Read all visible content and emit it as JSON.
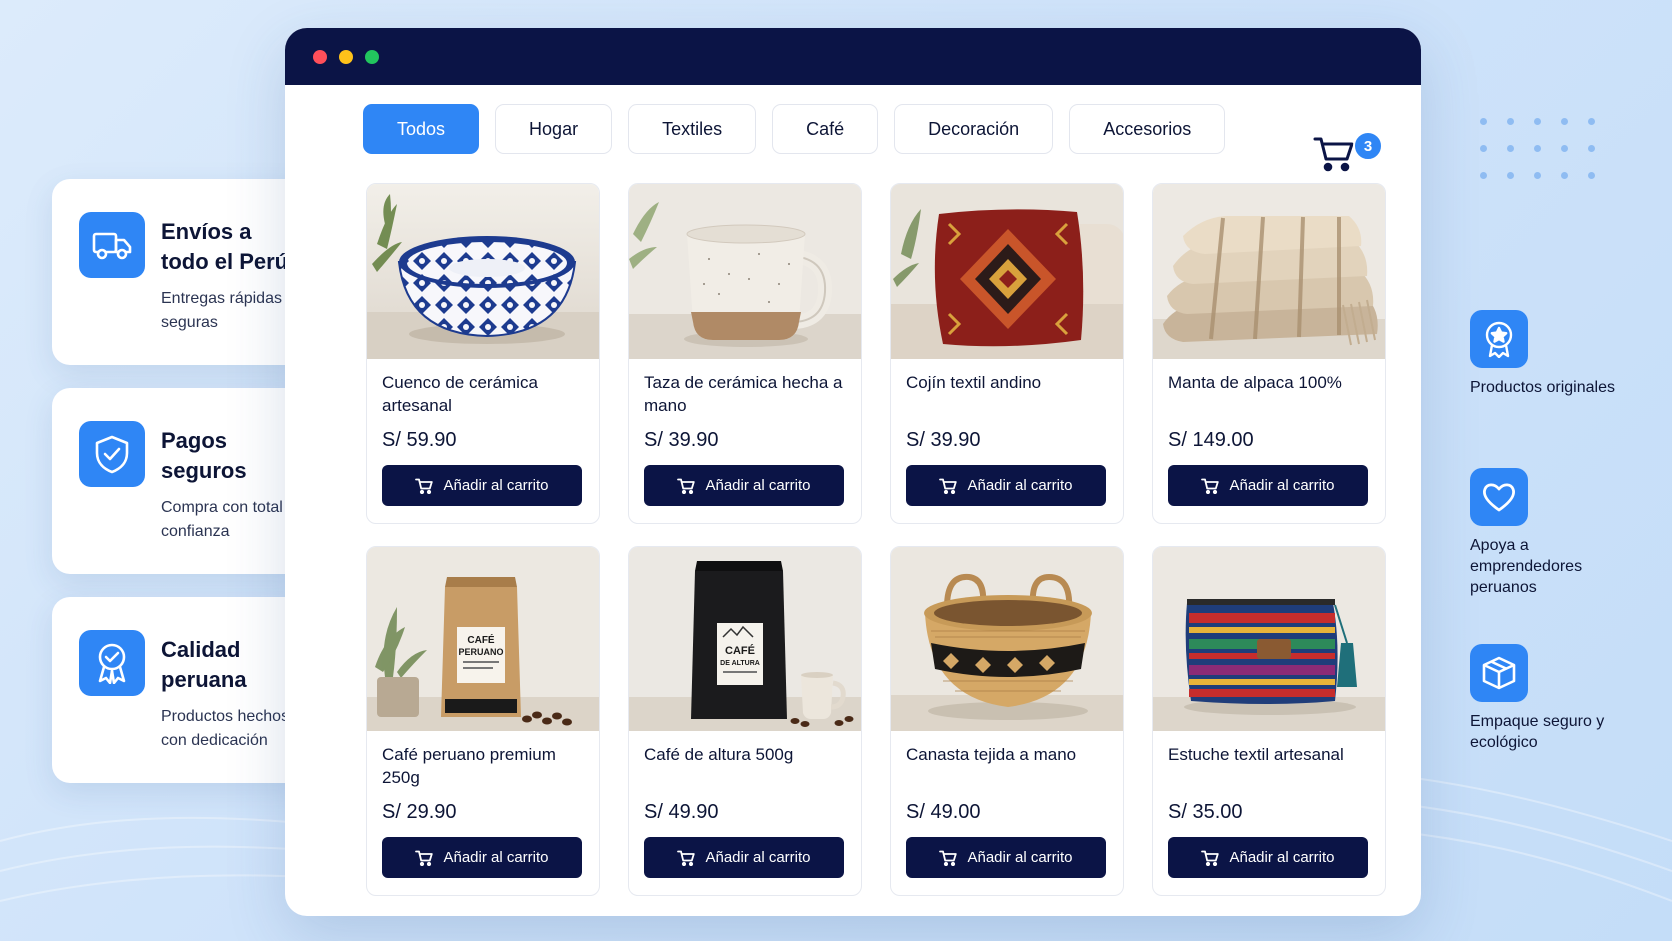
{
  "window": {
    "controls": [
      "close",
      "minimize",
      "maximize"
    ]
  },
  "categories": [
    "Todos",
    "Hogar",
    "Textiles",
    "Café",
    "Decoración",
    "Accesorios"
  ],
  "active_category": "Todos",
  "cart": {
    "icon": "cart-icon",
    "count": "3"
  },
  "products": [
    {
      "name": "Cuenco de cerámica artesanal",
      "price": "S/ 59.90",
      "button": "Añadir al carrito",
      "image": "ceramic-bowl"
    },
    {
      "name": "Taza de cerámica hecha a mano",
      "price": "S/ 39.90",
      "button": "Añadir al carrito",
      "image": "ceramic-mug"
    },
    {
      "name": "Cojín textil andino",
      "price": "S/ 39.90",
      "button": "Añadir al carrito",
      "image": "andean-cushion"
    },
    {
      "name": "Manta de alpaca 100%",
      "price": "S/ 149.00",
      "button": "Añadir al carrito",
      "image": "alpaca-blanket"
    },
    {
      "name": "Café peruano premium 250g",
      "price": "S/ 29.90",
      "button": "Añadir al carrito",
      "image": "coffee-bag-kraft",
      "label_lines": [
        "CAFÉ",
        "PERUANO"
      ]
    },
    {
      "name": "Café de altura 500g",
      "price": "S/ 49.90",
      "button": "Añadir al carrito",
      "image": "coffee-bag-black",
      "label_lines": [
        "CAFÉ",
        "DE ALTURA"
      ]
    },
    {
      "name": "Canasta tejida a mano",
      "price": "S/ 49.00",
      "button": "Añadir al carrito",
      "image": "woven-basket"
    },
    {
      "name": "Estuche textil artesanal",
      "price": "S/ 35.00",
      "button": "Añadir al carrito",
      "image": "textile-pouch"
    }
  ],
  "features": [
    {
      "title": "Envíos a todo el Perú",
      "desc": "Entregas rápidas y seguras",
      "icon": "truck-icon"
    },
    {
      "title": "Pagos seguros",
      "desc": "Compra con total confianza",
      "icon": "shield-check-icon"
    },
    {
      "title": "Calidad peruana",
      "desc": "Productos hechos con dedicación",
      "icon": "award-ribbon-icon"
    }
  ],
  "badges": [
    {
      "text": "Productos originales",
      "icon": "star-seal-icon"
    },
    {
      "text": "Apoya a emprendedores peruanos",
      "icon": "heart-icon"
    },
    {
      "text": "Empaque seguro y ecológico",
      "icon": "box-icon"
    }
  ],
  "colors": {
    "accent": "#2f86f5",
    "navy": "#0b1446",
    "background": "#d4e6fa"
  }
}
